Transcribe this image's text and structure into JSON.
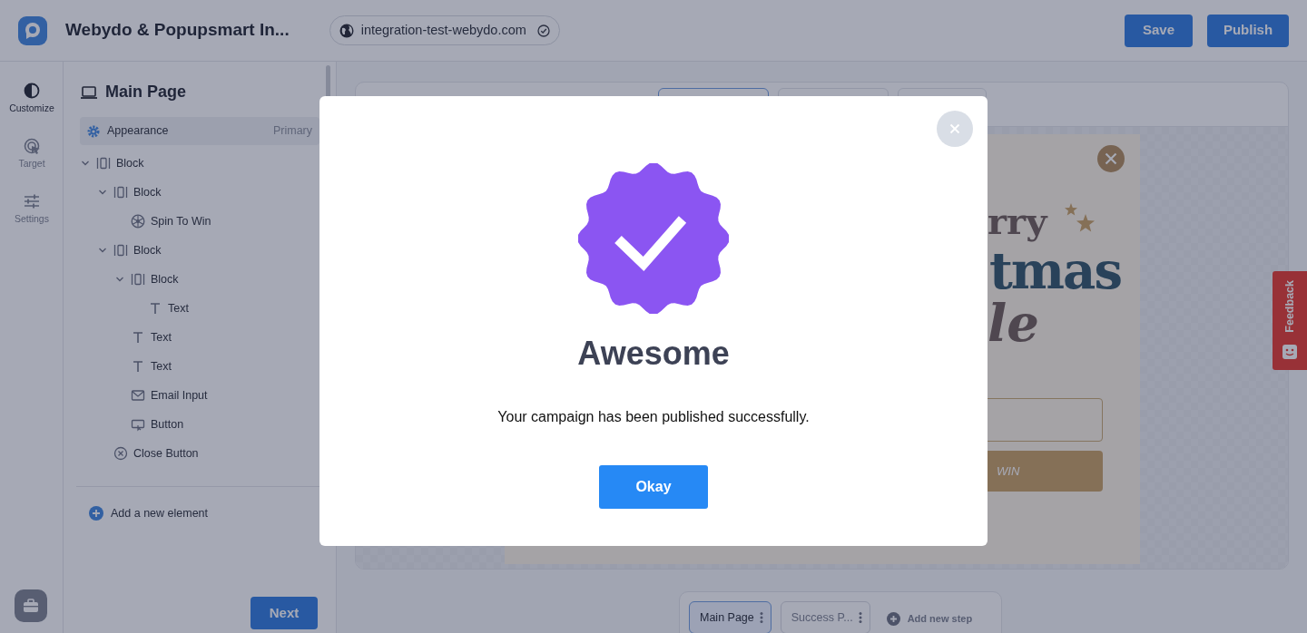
{
  "header": {
    "title": "Webydo & Popupsmart In...",
    "domain": "integration-test-webydo.com",
    "domain_verified": true,
    "buttons": [
      {
        "label": "Save"
      },
      {
        "label": "Publish"
      }
    ]
  },
  "rail": [
    {
      "label": "Customize",
      "kind": "customize",
      "selected": true
    },
    {
      "label": "Target",
      "kind": "target",
      "selected": false
    },
    {
      "label": "Settings",
      "kind": "settings",
      "selected": false
    }
  ],
  "panel": {
    "title": "Main Page",
    "appearance": {
      "label": "Appearance",
      "value": "Primary"
    },
    "tree": [
      {
        "label": "Block",
        "kind": "block",
        "expanded": true,
        "children": [
          {
            "label": "Block",
            "kind": "block",
            "expanded": true,
            "children": [
              {
                "label": "Spin To Win",
                "kind": "spin"
              }
            ]
          },
          {
            "label": "Block",
            "kind": "block",
            "expanded": true,
            "children": [
              {
                "label": "Block",
                "kind": "block",
                "expanded": true,
                "children": [
                  {
                    "label": "Text",
                    "kind": "text"
                  }
                ]
              },
              {
                "label": "Text",
                "kind": "text"
              },
              {
                "label": "Text",
                "kind": "text"
              },
              {
                "label": "Email Input",
                "kind": "email"
              },
              {
                "label": "Button",
                "kind": "button"
              }
            ]
          },
          {
            "label": "Close Button",
            "kind": "close"
          }
        ]
      }
    ],
    "add_element": "Add a new element",
    "next": "Next"
  },
  "device_tabs": [
    {
      "selected": true
    },
    {
      "selected": false
    },
    {
      "selected": false
    }
  ],
  "preview": {
    "line_1": "rry",
    "line_2": "tmas",
    "line_3": "le",
    "button": "WIN"
  },
  "steps": [
    {
      "label": "Main Page",
      "selected": true
    },
    {
      "label": "Success P...",
      "selected": false
    }
  ],
  "add_step": "Add new step",
  "feedback": "Feedback",
  "modal": {
    "title": "Awesome",
    "message": "Your campaign has been published successfully.",
    "button": "Okay"
  }
}
